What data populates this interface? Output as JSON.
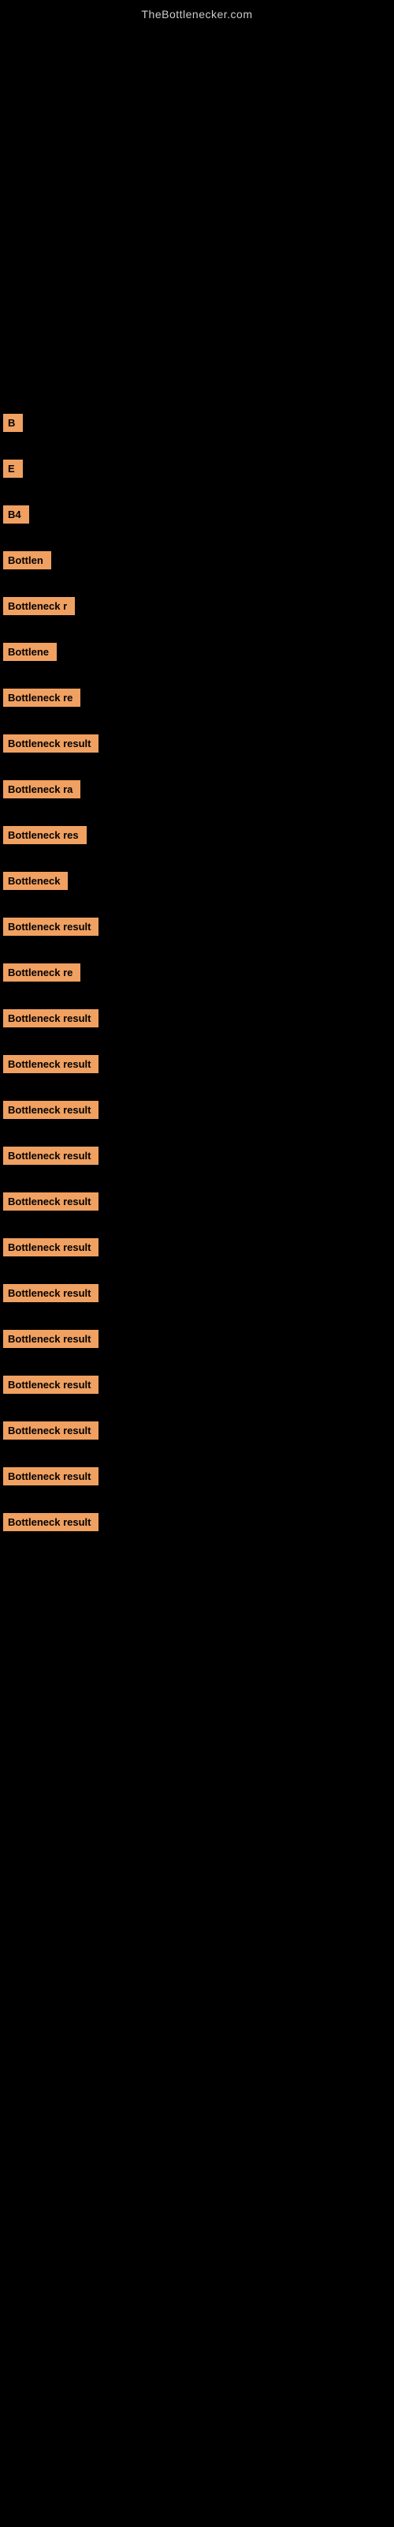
{
  "site": {
    "title": "TheBottlenecker.com"
  },
  "results": [
    {
      "id": 1,
      "label": "B",
      "size": "small"
    },
    {
      "id": 2,
      "label": "E",
      "size": "small"
    },
    {
      "id": 3,
      "label": "B4",
      "size": "medium-sm"
    },
    {
      "id": 4,
      "label": "Bottlen",
      "size": "medium"
    },
    {
      "id": 5,
      "label": "Bottleneck r",
      "size": "medium-lg"
    },
    {
      "id": 6,
      "label": "Bottlene",
      "size": "medium"
    },
    {
      "id": 7,
      "label": "Bottleneck re",
      "size": "medium-lg"
    },
    {
      "id": 8,
      "label": "Bottleneck result",
      "size": "large"
    },
    {
      "id": 9,
      "label": "Bottleneck ra",
      "size": "medium-lg"
    },
    {
      "id": 10,
      "label": "Bottleneck res",
      "size": "large"
    },
    {
      "id": 11,
      "label": "Bottleneck",
      "size": "medium-lg"
    },
    {
      "id": 12,
      "label": "Bottleneck result",
      "size": "large"
    },
    {
      "id": 13,
      "label": "Bottleneck re",
      "size": "medium-lg"
    },
    {
      "id": 14,
      "label": "Bottleneck result",
      "size": "larger"
    },
    {
      "id": 15,
      "label": "Bottleneck result",
      "size": "larger"
    },
    {
      "id": 16,
      "label": "Bottleneck result",
      "size": "larger"
    },
    {
      "id": 17,
      "label": "Bottleneck result",
      "size": "larger"
    },
    {
      "id": 18,
      "label": "Bottleneck result",
      "size": "larger"
    },
    {
      "id": 19,
      "label": "Bottleneck result",
      "size": "larger"
    },
    {
      "id": 20,
      "label": "Bottleneck result",
      "size": "larger"
    },
    {
      "id": 21,
      "label": "Bottleneck result",
      "size": "larger"
    },
    {
      "id": 22,
      "label": "Bottleneck result",
      "size": "larger"
    },
    {
      "id": 23,
      "label": "Bottleneck result",
      "size": "larger"
    },
    {
      "id": 24,
      "label": "Bottleneck result",
      "size": "larger"
    },
    {
      "id": 25,
      "label": "Bottleneck result",
      "size": "larger"
    }
  ]
}
